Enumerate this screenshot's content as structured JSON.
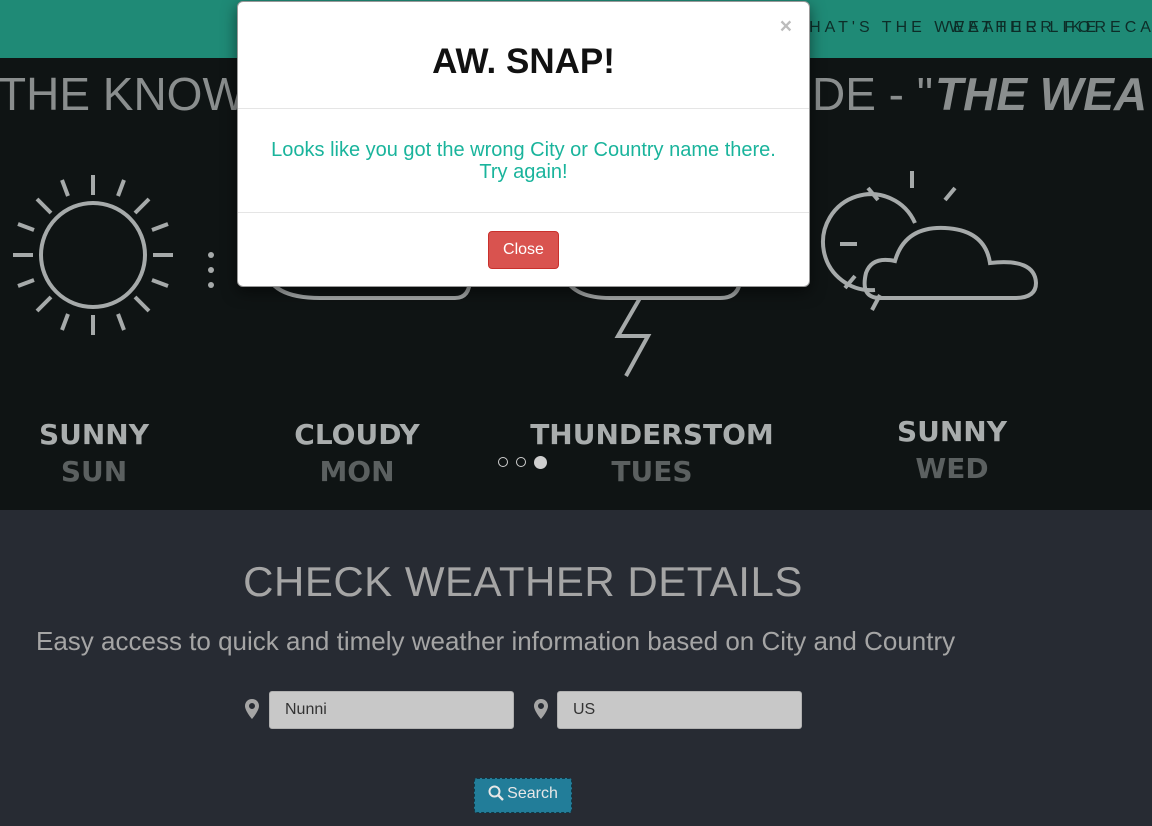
{
  "nav": {
    "links": [
      "WHAT'S THE WEATHER LIKE",
      "WEATHER FORECAST"
    ]
  },
  "hero": {
    "banner_text_start": "THE KNOWLEDGE ",
    "banner_text_mid": "DE - \"",
    "banner_text_italic": "THE WEA",
    "days": [
      {
        "condition": "SUNNY",
        "day": "SUN"
      },
      {
        "condition": "CLOUDY",
        "day": "MON"
      },
      {
        "condition": "THUNDERSTOM",
        "day": "TUES"
      },
      {
        "condition": "SUNNY",
        "day": "WED"
      }
    ],
    "carousel_active_index": 2,
    "carousel_count": 3
  },
  "weather": {
    "title": "CHECK WEATHER DETAILS",
    "subtitle": "Easy access to quick and timely weather information based on City and Country",
    "city_value": "Nunni",
    "country_value": "US",
    "search_label": "Search",
    "icons": [
      "map-marker-icon",
      "search-icon"
    ]
  },
  "modal": {
    "close_symbol": "×",
    "title": "AW. SNAP!",
    "message_line1": "Looks like you got the wrong City or Country name there.",
    "message_line2": "Try again!",
    "close_label": "Close"
  },
  "colors": {
    "navbar": "#1f8a76",
    "message": "#1ab49c",
    "close_button": "#d9534f",
    "search_button": "#227d99"
  }
}
